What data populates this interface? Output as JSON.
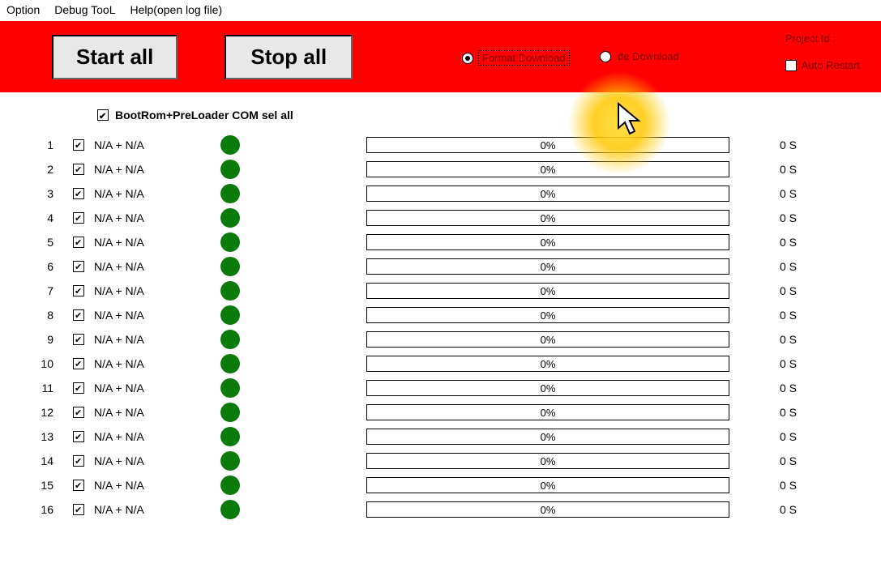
{
  "menu": {
    "option": "Option",
    "debug": "Debug TooL",
    "help": "Help(open log file)"
  },
  "toolbar": {
    "start_all": "Start all",
    "stop_all": "Stop all",
    "radio_format": "Format Download",
    "radio_firmware": "de Download",
    "project_id_label": "Project Id :",
    "auto_restart_label": "Auto Restart"
  },
  "select_all_label": "BootRom+PreLoader COM sel all",
  "rows": [
    {
      "idx": "1",
      "label": "N/A + N/A",
      "progress": "0%",
      "time": "0 S"
    },
    {
      "idx": "2",
      "label": "N/A + N/A",
      "progress": "0%",
      "time": "0 S"
    },
    {
      "idx": "3",
      "label": "N/A + N/A",
      "progress": "0%",
      "time": "0 S"
    },
    {
      "idx": "4",
      "label": "N/A + N/A",
      "progress": "0%",
      "time": "0 S"
    },
    {
      "idx": "5",
      "label": "N/A + N/A",
      "progress": "0%",
      "time": "0 S"
    },
    {
      "idx": "6",
      "label": "N/A + N/A",
      "progress": "0%",
      "time": "0 S"
    },
    {
      "idx": "7",
      "label": "N/A + N/A",
      "progress": "0%",
      "time": "0 S"
    },
    {
      "idx": "8",
      "label": "N/A + N/A",
      "progress": "0%",
      "time": "0 S"
    },
    {
      "idx": "9",
      "label": "N/A + N/A",
      "progress": "0%",
      "time": "0 S"
    },
    {
      "idx": "10",
      "label": "N/A + N/A",
      "progress": "0%",
      "time": "0 S"
    },
    {
      "idx": "11",
      "label": "N/A + N/A",
      "progress": "0%",
      "time": "0 S"
    },
    {
      "idx": "12",
      "label": "N/A + N/A",
      "progress": "0%",
      "time": "0 S"
    },
    {
      "idx": "13",
      "label": "N/A + N/A",
      "progress": "0%",
      "time": "0 S"
    },
    {
      "idx": "14",
      "label": "N/A + N/A",
      "progress": "0%",
      "time": "0 S"
    },
    {
      "idx": "15",
      "label": "N/A + N/A",
      "progress": "0%",
      "time": "0 S"
    },
    {
      "idx": "16",
      "label": "N/A + N/A",
      "progress": "0%",
      "time": "0 S"
    }
  ]
}
